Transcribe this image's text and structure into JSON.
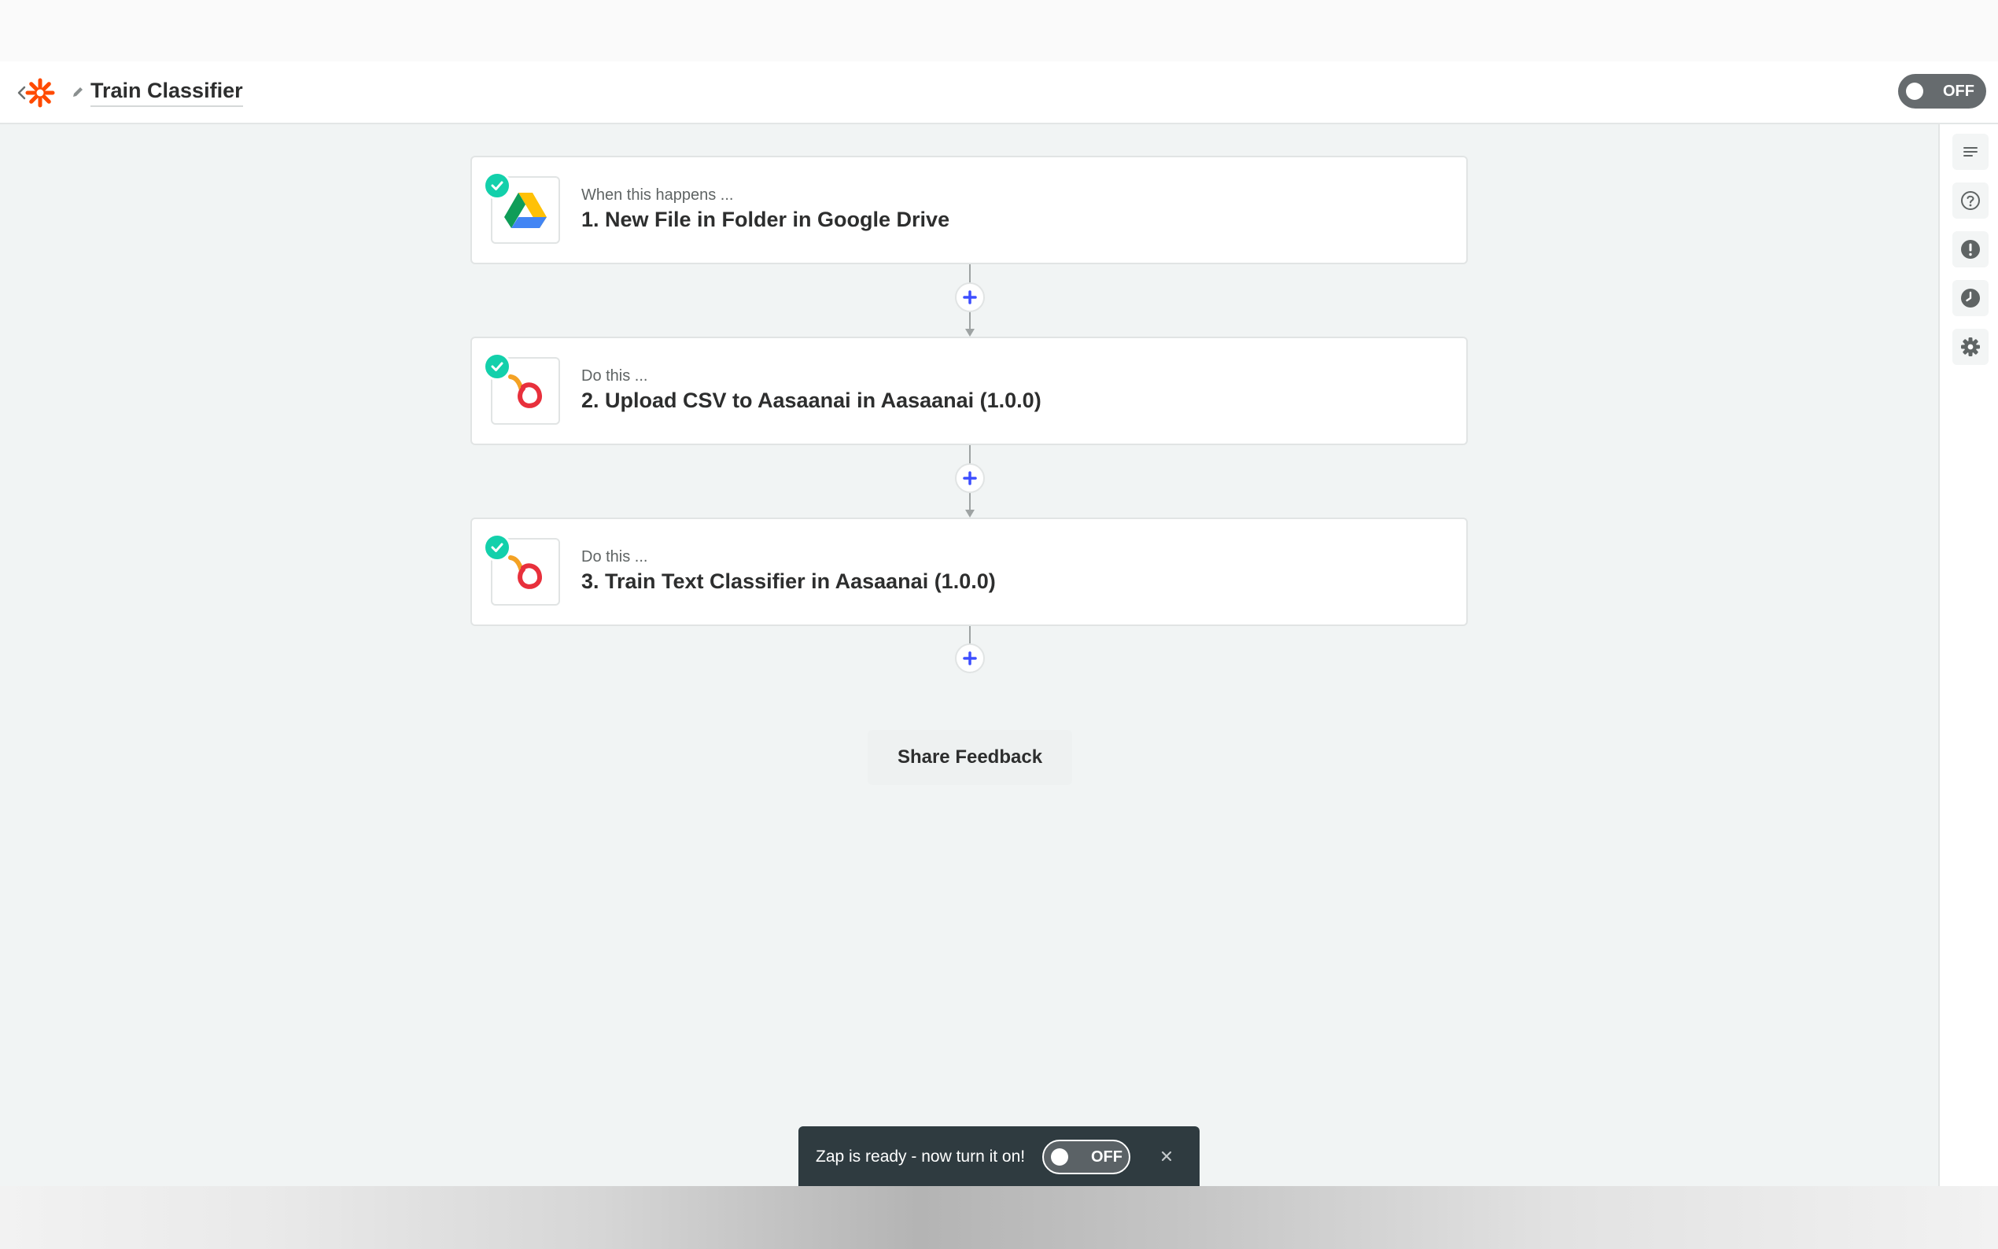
{
  "header": {
    "title": "Train Classifier",
    "toggle_label": "OFF"
  },
  "steps": [
    {
      "kicker": "When this happens ...",
      "title": "1. New File in Folder in Google Drive",
      "icon": "google-drive-icon"
    },
    {
      "kicker": "Do this ...",
      "title": "2. Upload CSV to Aasaanai in Aasaanai (1.0.0)",
      "icon": "aasaanai-icon"
    },
    {
      "kicker": "Do this ...",
      "title": "3. Train Text Classifier in Aasaanai (1.0.0)",
      "icon": "aasaanai-icon"
    }
  ],
  "sidebar": {
    "items": [
      {
        "icon": "list-icon"
      },
      {
        "icon": "help-icon"
      },
      {
        "icon": "alert-icon"
      },
      {
        "icon": "history-icon"
      },
      {
        "icon": "settings-icon"
      }
    ]
  },
  "feedback_label": "Share Feedback",
  "toast": {
    "message": "Zap is ready - now turn it on!",
    "toggle_label": "OFF"
  },
  "colors": {
    "brand": "#ff4a00",
    "check": "#13d0ab",
    "add": "#3d4eff",
    "toast_bg": "#2f3b40",
    "toggle_off": "#666b6e"
  }
}
